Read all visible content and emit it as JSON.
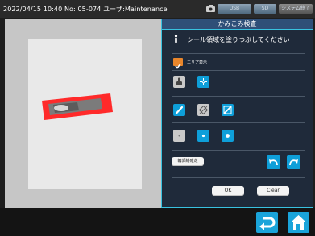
{
  "status": {
    "datetime": "2022/04/15 10:40",
    "number": "No: 05-074",
    "user": "ユーザ:Maintenance"
  },
  "toolbar": {
    "camera_icon": "camera-icon",
    "usb_label": "USB",
    "sd_label": "SD",
    "system_exit_label": "システム終了"
  },
  "panel": {
    "title": "かみこみ検査",
    "instruction": "シール領域を塗りつぶしてください",
    "area_display_label": "エリア表示",
    "area_display_checked": true,
    "contour_fix_label": "輪郭線確定",
    "ok_label": "OK",
    "clear_label": "Clear"
  },
  "colors": {
    "accent": "#0e9fd9",
    "checkbox": "#e9862b",
    "seal_area": "#ff2a2a",
    "panel_border": "#39c2e0"
  }
}
